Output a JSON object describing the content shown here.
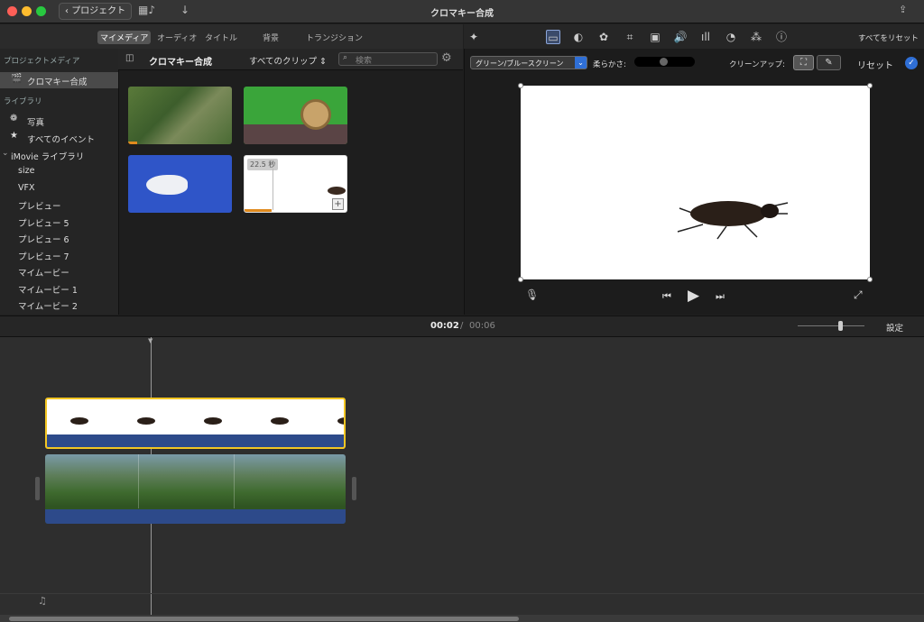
{
  "titlebar": {
    "back": "プロジェクト",
    "title": "クロマキー合成"
  },
  "tabs": [
    "マイメディア",
    "オーディオ",
    "タイトル",
    "背景",
    "トランジション"
  ],
  "sidebar": {
    "project_media_header": "プロジェクトメディア",
    "project_item": "クロマキー合成",
    "library_header": "ライブラリ",
    "photos": "写真",
    "all_events": "すべてのイベント",
    "imovie_library": "iMovie ライブラリ",
    "events": [
      "size",
      "VFX",
      "プレビュー",
      "プレビュー 5",
      "プレビュー 6",
      "プレビュー 7",
      "マイムービー",
      "マイムービー 1",
      "マイムービー 2"
    ]
  },
  "browser": {
    "title": "クロマキー合成",
    "filter": "すべてのクリップ",
    "search_placeholder": "検索",
    "clip_duration": "22.5 秒"
  },
  "viewer": {
    "reset_all": "すべてをリセット",
    "overlay_mode": "グリーン/ブルースクリーン",
    "softness_label": "柔らかさ:",
    "cleanup_label": "クリーンアップ:",
    "reset": "リセット"
  },
  "timeline": {
    "current_time": "00:02",
    "separator": "/",
    "total_time": "00:06",
    "settings": "設定"
  },
  "colors": {
    "accent": "#2f6fd6",
    "selection": "#f3c623",
    "clip_blue": "#2d4a8a"
  }
}
